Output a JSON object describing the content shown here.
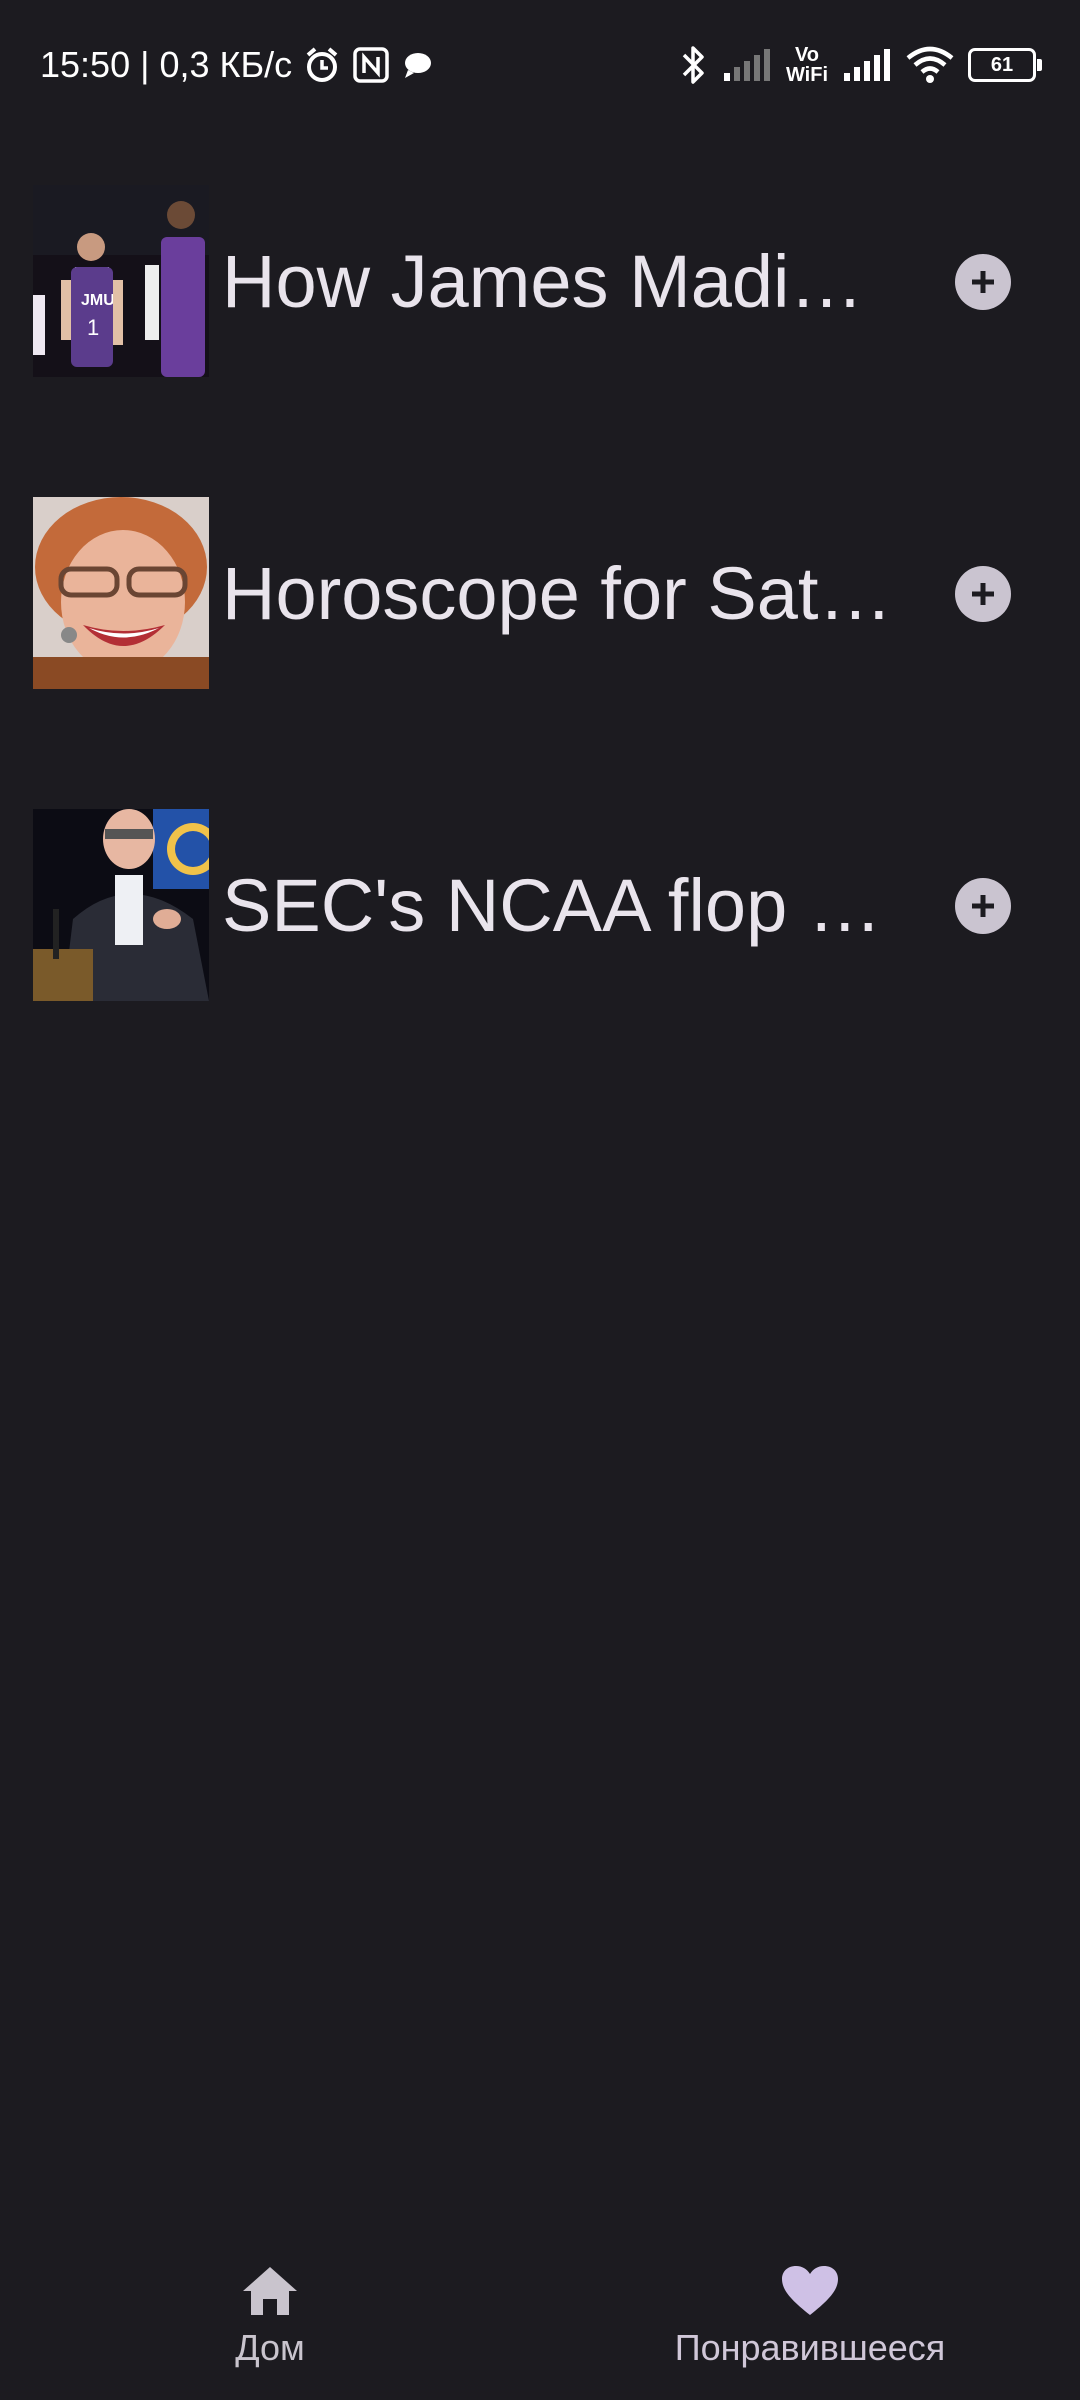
{
  "status_bar": {
    "time": "15:50",
    "separator": "|",
    "network_speed": "0,3 КБ/с",
    "volte_top": "Vo",
    "volte_bottom": "WiFi",
    "battery": "61"
  },
  "articles": [
    {
      "title": "How James Madi…",
      "thumb": "basketball-players-photo"
    },
    {
      "title": "Horoscope for Sat…",
      "thumb": "smiling-woman-glasses-photo"
    },
    {
      "title": "SEC's NCAA flop …",
      "thumb": "man-speaking-podium-photo"
    }
  ],
  "bottom_nav": {
    "home_label": "Дом",
    "favorites_label": "Понравившееся"
  },
  "colors": {
    "background": "#1c1b20",
    "text": "#e9e4ec",
    "add_button": "#cac4d0",
    "favorite_accent": "#cfc1e6"
  }
}
